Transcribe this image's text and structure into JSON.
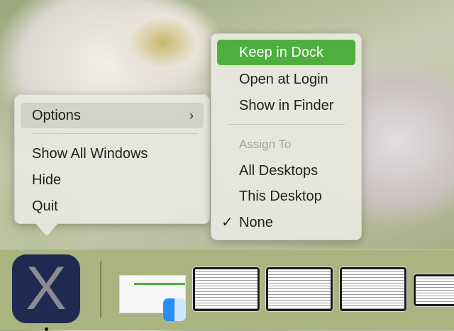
{
  "context_menu": {
    "options_label": "Options",
    "items": [
      "Show All Windows",
      "Hide",
      "Quit"
    ]
  },
  "options_submenu": {
    "items": [
      "Keep in Dock",
      "Open at Login",
      "Show in Finder"
    ],
    "assign_header": "Assign To",
    "assign_items": [
      "All Desktops",
      "This Desktop",
      "None"
    ],
    "checked": "None",
    "highlight_color": "#4daf3e"
  },
  "dock": {
    "app_icon_letter": "X",
    "app_icon_color": "#1e2a4f"
  }
}
